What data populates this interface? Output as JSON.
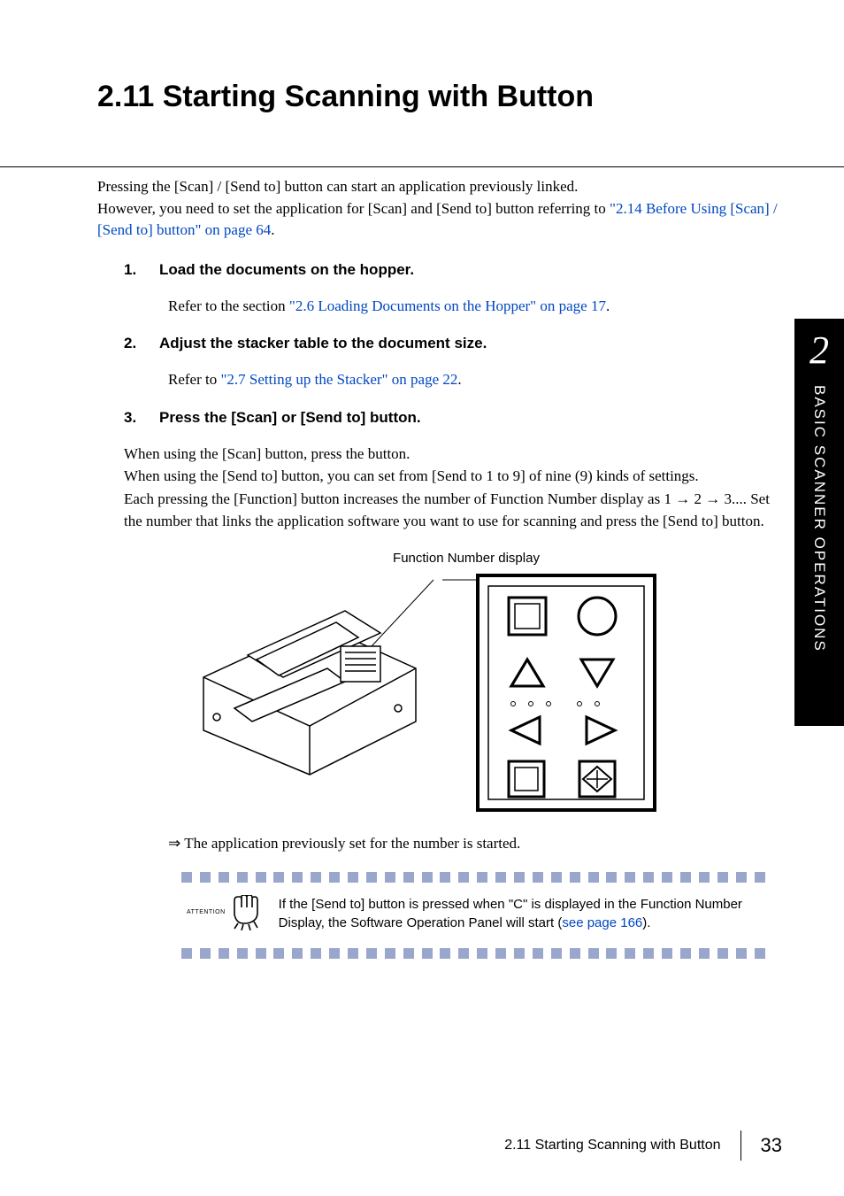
{
  "title": "2.11 Starting Scanning with Button",
  "intro": {
    "line1": "Pressing the [Scan] / [Send to] button can start an application previously linked.",
    "line2a": "However, you need to set the application for [Scan] and [Send to] button referring to ",
    "link1": "\"2.14 Before Using [Scan] / [Send to] button\" on page 64",
    "line2b": "."
  },
  "steps": [
    {
      "num": "1.",
      "heading": "Load the documents on the hopper.",
      "body_a": "Refer to the section ",
      "body_link": "\"2.6 Loading Documents on the Hopper\" on page 17",
      "body_b": "."
    },
    {
      "num": "2.",
      "heading": "Adjust the stacker table to the document size.",
      "body_a": "Refer to ",
      "body_link": "\"2.7 Setting up the Stacker\" on page 22",
      "body_b": "."
    },
    {
      "num": "3.",
      "heading": "Press the [Scan] or [Send to] button.",
      "body_lines": [
        "When using the [Scan] button, press the button.",
        "When using the [Send to] button, you can set from [Send to 1 to 9] of nine (9) kinds of settings.",
        "Each pressing the [Function] button increases the number of Function Number display as 1 → 2 → 3.... Set the number that links the application software you want to use for scanning and press the [Send to] button."
      ]
    }
  ],
  "figure_caption": "Function Number display",
  "result_line": "The application previously set for the number is started.",
  "result_arrow": "⇒",
  "attention": {
    "label": "ATTENTION",
    "text_a": "If the [Send to] button is pressed when \"C\" is displayed in the Function Number Display, the Software Operation Panel will start (",
    "link": "see page 166",
    "text_b": ")."
  },
  "side": {
    "chapter": "2",
    "label": "BASIC SCANNER OPERATIONS"
  },
  "footer": {
    "section": "2.11 Starting Scanning with Button",
    "page": "33"
  }
}
